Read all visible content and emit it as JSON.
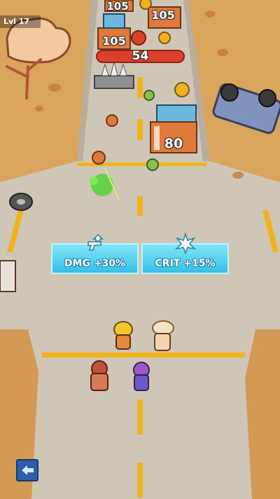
{
  "hud": {
    "level_label": "Lvl 17"
  },
  "enemy_counts": {
    "top_left": "105",
    "top_right": "105",
    "mid_left": "105",
    "boss_hp": "54",
    "crate": "80"
  },
  "gates": [
    {
      "label": "DMG +30%",
      "icon": "pistol-upgrade-icon"
    },
    {
      "label": "CRIT +15%",
      "icon": "crit-burst-icon"
    }
  ],
  "controls": {
    "back_icon": "left-arrow-icon"
  },
  "colors": {
    "sand": "#d9a55c",
    "road": "#cfc6b8",
    "lane_line": "#f2b21a",
    "gate": "#43cdf0",
    "hp_bar": "#d9412c",
    "back_button": "#2c5fa8"
  }
}
